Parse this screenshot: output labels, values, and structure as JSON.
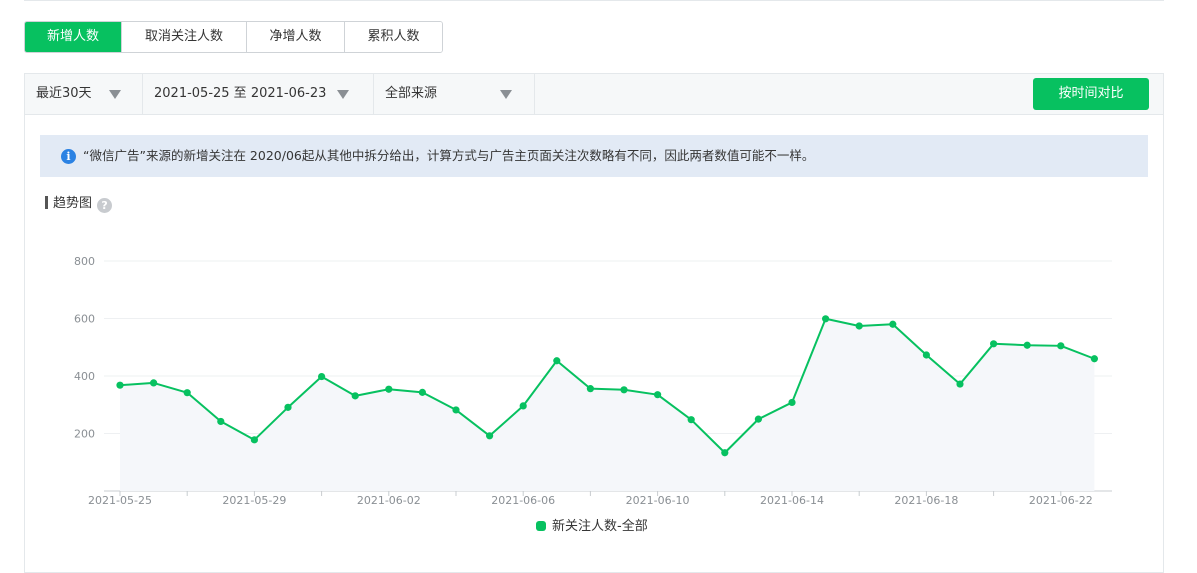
{
  "tabs": [
    {
      "label": "新增人数",
      "active": true
    },
    {
      "label": "取消关注人数",
      "active": false
    },
    {
      "label": "净增人数",
      "active": false
    },
    {
      "label": "累积人数",
      "active": false
    }
  ],
  "filters": {
    "period": "最近30天",
    "date_range": "2021-05-25 至 2021-06-23",
    "source": "全部来源",
    "compare_button": "按时间对比"
  },
  "notice": {
    "icon": "info-icon",
    "text": "“微信广告”来源的新增关注在 2020/06起从其他中拆分给出，计算方式与广告主页面关注次数略有不同，因此两者数值可能不一样。"
  },
  "section": {
    "title": "趋势图",
    "help_icon": "help-icon"
  },
  "colors": {
    "accent": "#07c160",
    "notice_bg": "#e2eaf5",
    "info_blue": "#2b82e3"
  },
  "chart_data": {
    "type": "line",
    "x": [
      "2021-05-25",
      "2021-05-26",
      "2021-05-27",
      "2021-05-28",
      "2021-05-29",
      "2021-05-30",
      "2021-05-31",
      "2021-06-01",
      "2021-06-02",
      "2021-06-03",
      "2021-06-04",
      "2021-06-05",
      "2021-06-06",
      "2021-06-07",
      "2021-06-08",
      "2021-06-09",
      "2021-06-10",
      "2021-06-11",
      "2021-06-12",
      "2021-06-13",
      "2021-06-14",
      "2021-06-15",
      "2021-06-16",
      "2021-06-17",
      "2021-06-18",
      "2021-06-19",
      "2021-06-20",
      "2021-06-21",
      "2021-06-22",
      "2021-06-23"
    ],
    "x_tick_labels": [
      "2021-05-25",
      "2021-05-29",
      "2021-06-02",
      "2021-06-06",
      "2021-06-10",
      "2021-06-14",
      "2021-06-18",
      "2021-06-22"
    ],
    "y_ticks": [
      200,
      400,
      600,
      800
    ],
    "ylim": [
      0,
      800
    ],
    "series": [
      {
        "name": "新关注人数-全部",
        "color": "#07c160",
        "values": [
          368,
          376,
          342,
          242,
          178,
          291,
          398,
          331,
          354,
          343,
          282,
          192,
          296,
          453,
          356,
          352,
          335,
          248,
          133,
          250,
          308,
          599,
          574,
          580,
          473,
          372,
          512,
          507,
          505,
          460
        ]
      }
    ],
    "grid": true,
    "legend": "bottom-center",
    "area_fill": true
  }
}
